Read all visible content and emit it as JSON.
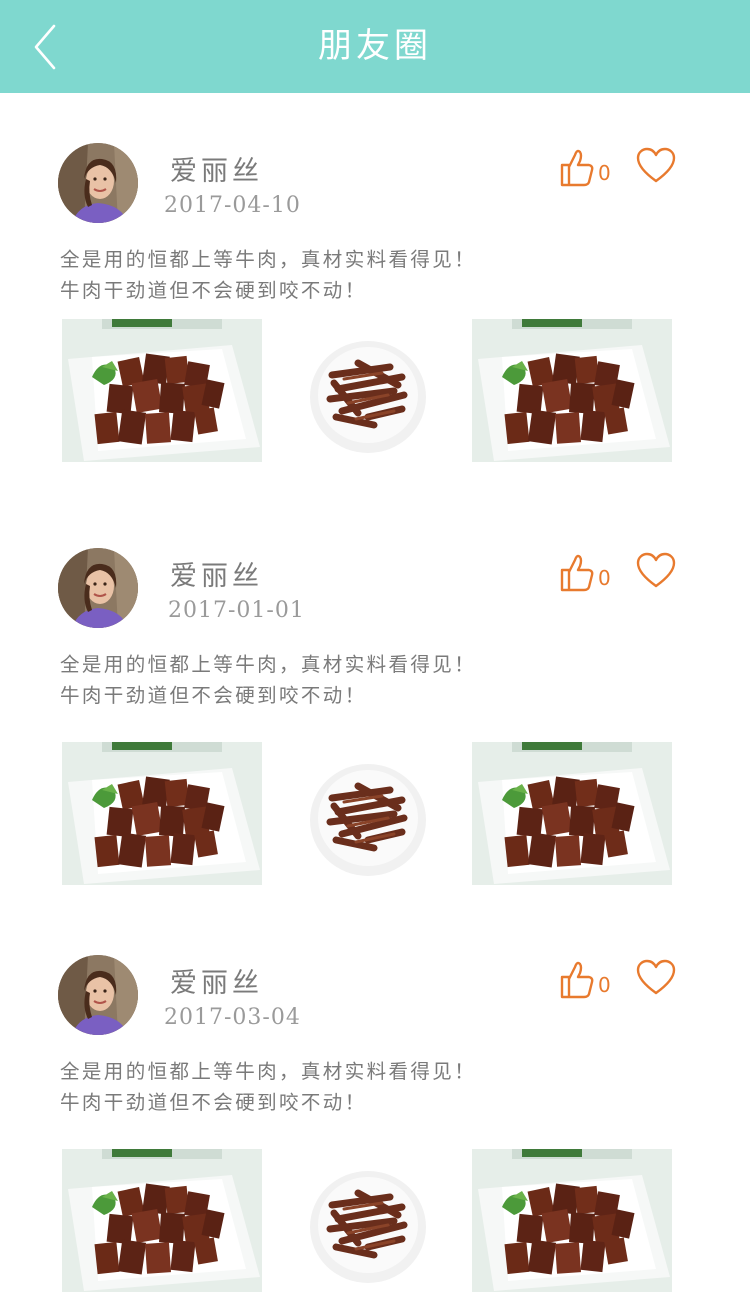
{
  "header": {
    "title": "朋友圈",
    "back_icon": "chevron-left-icon"
  },
  "colors": {
    "header_bg": "#7fd8cf",
    "accent": "#e87a2e",
    "text": "#7a7a7a"
  },
  "posts": [
    {
      "author": "爱丽丝",
      "date": "2017-04-10",
      "likes": "0",
      "text_line1": "全是用的恒都上等牛肉，真材实料看得见！",
      "text_line2": "牛肉干劲道但不会硬到咬不动！",
      "photos": [
        "beef-jerky-plate",
        "beef-strips-bowl",
        "beef-jerky-plate"
      ]
    },
    {
      "author": "爱丽丝",
      "date": "2017-01-01",
      "likes": "0",
      "text_line1": "全是用的恒都上等牛肉，真材实料看得见！",
      "text_line2": "牛肉干劲道但不会硬到咬不动！",
      "photos": [
        "beef-jerky-plate",
        "beef-strips-bowl",
        "beef-jerky-plate"
      ]
    },
    {
      "author": "爱丽丝",
      "date": "2017-03-04",
      "likes": "0",
      "text_line1": "全是用的恒都上等牛肉，真材实料看得见！",
      "text_line2": "牛肉干劲道但不会硬到咬不动！",
      "photos": [
        "beef-jerky-plate",
        "beef-strips-bowl",
        "beef-jerky-plate"
      ]
    }
  ]
}
